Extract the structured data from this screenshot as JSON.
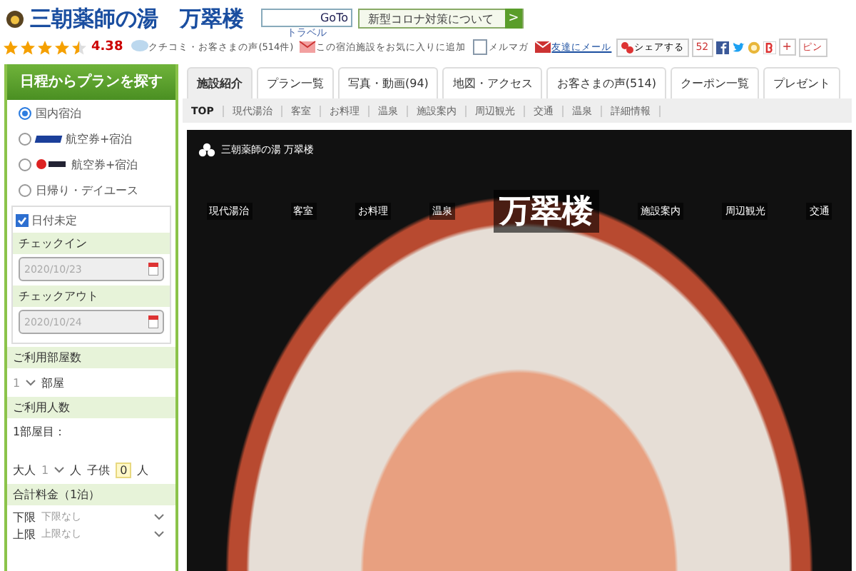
{
  "header": {
    "title": "三朝薬師の湯　万翠楼",
    "goto_badge": {
      "top": "GoTo",
      "bottom": "トラベル"
    },
    "covid_button": {
      "label": "新型コロナ対策について",
      "arrow": ">"
    },
    "stars": 4.5,
    "rating": "4.38",
    "links": [
      {
        "kind": "reviews",
        "label": "クチコミ・お客さまの声(514件)"
      },
      {
        "kind": "favorite",
        "label": "この宿泊施設をお気に入りに追加"
      },
      {
        "kind": "mail",
        "label": "メルマガ"
      },
      {
        "kind": "friend",
        "label": "友達にメール"
      }
    ],
    "share": {
      "label": "シェアする",
      "count": "52",
      "pin": "ピン",
      "plus": "+"
    }
  },
  "sidebar": {
    "title": "日程からプランを探す",
    "plan_types": [
      {
        "kind": "plain",
        "label": "国内宿泊",
        "selected": true
      },
      {
        "kind": "ana",
        "label": "航空券+宿泊",
        "selected": false
      },
      {
        "kind": "jal",
        "label": "航空券+宿泊",
        "selected": false
      },
      {
        "kind": "plain",
        "label": "日帰り・デイユース",
        "selected": false
      }
    ],
    "date_undecided": {
      "label": "日付未定",
      "checked": true
    },
    "checkin": {
      "label": "チェックイン",
      "value": "2020/10/23"
    },
    "checkout": {
      "label": "チェックアウト",
      "value": "2020/10/24"
    },
    "rooms": {
      "label": "ご利用部屋数",
      "value": "1",
      "unit": "部屋"
    },
    "guests": {
      "label": "ご利用人数",
      "room": "1部屋目：",
      "adult_label": "大人",
      "adults": "1",
      "adult_unit": "人",
      "child_label": "子供",
      "children": "0",
      "child_unit": "人"
    },
    "price": {
      "label": "合計料金（1泊）",
      "min_label": "下限",
      "min": "下限なし",
      "max_label": "上限",
      "max": "上限なし"
    }
  },
  "tabs": [
    {
      "label": "施設紹介",
      "selected": true
    },
    {
      "label": "プラン一覧",
      "selected": false
    },
    {
      "label": "写真・動画(94)",
      "selected": false
    },
    {
      "label": "地図・アクセス",
      "selected": false
    },
    {
      "label": "お客さまの声(514)",
      "selected": false
    },
    {
      "label": "クーポン一覧",
      "selected": false
    },
    {
      "label": "プレゼント",
      "selected": false
    }
  ],
  "subnav": [
    {
      "label": "TOP",
      "selected": true
    },
    {
      "label": "現代湯治",
      "selected": false
    },
    {
      "label": "客室",
      "selected": false
    },
    {
      "label": "お料理",
      "selected": false
    },
    {
      "label": "温泉",
      "selected": false
    },
    {
      "label": "施設案内",
      "selected": false
    },
    {
      "label": "周辺観光",
      "selected": false
    },
    {
      "label": "交通",
      "selected": false
    },
    {
      "label": "温泉",
      "selected": false
    },
    {
      "label": "詳細情報",
      "selected": false
    }
  ],
  "hero": {
    "brand": "三朝薬師の湯 万翠楼",
    "logo": "万翠楼",
    "menu_left": [
      "現代湯治",
      "客室",
      "お料理",
      "温泉"
    ],
    "menu_right": [
      "施設案内",
      "周辺観光",
      "交通"
    ]
  }
}
